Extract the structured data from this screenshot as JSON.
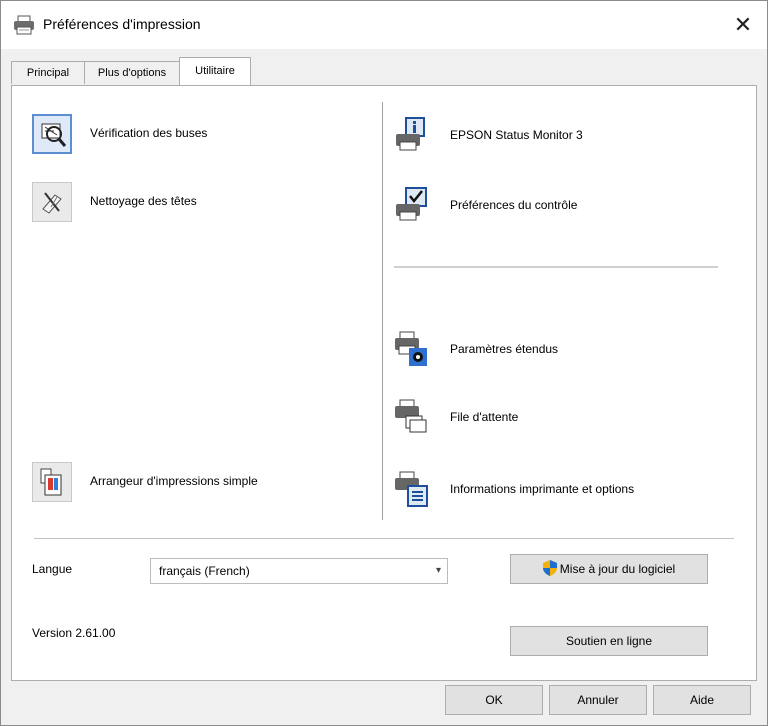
{
  "window": {
    "title": "Préférences d'impression",
    "close_icon": "close-icon",
    "title_icon": "printer-icon"
  },
  "tabs": [
    {
      "label": "Principal"
    },
    {
      "label": "Plus d'options"
    },
    {
      "label": "Utilitaire",
      "selected": true
    }
  ],
  "left_items": [
    {
      "label": "Vérification des buses",
      "icon": "nozzle-check-icon"
    },
    {
      "label": "Nettoyage des têtes",
      "icon": "head-cleaning-icon"
    },
    {
      "label": "Arrangeur d'impressions simple",
      "icon": "job-arranger-icon"
    }
  ],
  "right_items": [
    {
      "label": "EPSON Status Monitor 3",
      "icon": "status-monitor-icon"
    },
    {
      "label": "Préférences du contrôle",
      "icon": "monitoring-preferences-icon"
    },
    {
      "label": "Paramètres étendus",
      "icon": "extended-settings-icon"
    },
    {
      "label": "File d'attente",
      "icon": "print-queue-icon"
    },
    {
      "label": "Informations imprimante et options",
      "icon": "printer-info-icon"
    }
  ],
  "language": {
    "label": "Langue",
    "value": "français (French)"
  },
  "update_button": {
    "label": "Mise à jour du logiciel",
    "icon": "shield-icon"
  },
  "version": "Version 2.61.00",
  "support_button": {
    "label": "Soutien en ligne"
  },
  "footer": {
    "ok": "OK",
    "cancel": "Annuler",
    "help": "Aide"
  }
}
